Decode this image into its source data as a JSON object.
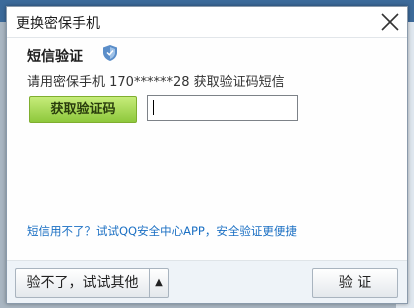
{
  "dialog": {
    "title": "更换密保手机"
  },
  "verify": {
    "heading": "短信验证",
    "description": "请用密保手机 170******28 获取验证码短信",
    "get_code_label": "获取验证码",
    "code_value": "",
    "help_link": "短信用不了？试试QQ安全中心APP，安全验证更便捷"
  },
  "footer": {
    "alt_label": "验不了，试试其他",
    "alt_arrow": "▲",
    "confirm_label": "验 证"
  },
  "colors": {
    "accent_green": "#8ec83c",
    "link_blue": "#1a6fc3",
    "shield_blue": "#5b8ec9"
  }
}
